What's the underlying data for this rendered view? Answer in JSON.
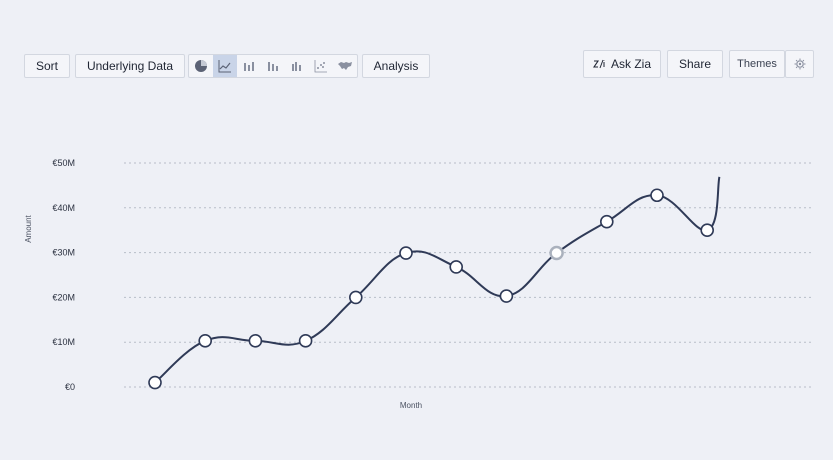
{
  "toolbar": {
    "sort_label": "Sort",
    "underlying_label": "Underlying Data",
    "analysis_label": "Analysis",
    "chart_types": [
      {
        "icon": "pie-chart-icon",
        "active": false
      },
      {
        "icon": "line-chart-icon",
        "active": true
      },
      {
        "icon": "bar-chart-icon",
        "active": false
      },
      {
        "icon": "stacked-bar-chart-icon",
        "active": false
      },
      {
        "icon": "grouped-bar-chart-icon",
        "active": false
      },
      {
        "icon": "scatter-chart-icon",
        "active": false
      },
      {
        "icon": "map-chart-icon",
        "active": false
      }
    ]
  },
  "right_tools": {
    "ask_zia_label": "Ask Zia",
    "ask_zia_icon": "zia-icon",
    "share_label": "Share",
    "themes_label": "Themes",
    "settings_icon": "gear-icon"
  },
  "colors": {
    "line": "#2f3a57",
    "marker_fill": "#ffffff",
    "highlight_marker": "#aab1bd",
    "grid": "#b8bdc8",
    "background": "#eef0f6"
  },
  "chart_data": {
    "type": "line",
    "title": "",
    "xlabel": "Month",
    "ylabel": "Amount",
    "ylim": [
      0,
      50
    ],
    "yticks": [
      0,
      10,
      20,
      30,
      40,
      50
    ],
    "ytick_labels": [
      "€0",
      "€10M",
      "€20M",
      "€30M",
      "€40M",
      "€50M"
    ],
    "grid": true,
    "smooth": true,
    "series": [
      {
        "values": [
          1,
          10.3,
          10.3,
          10.3,
          20,
          29.9,
          26.8,
          20.3,
          29.9,
          36.9,
          42.8,
          35
        ],
        "highlight_index": 8
      }
    ],
    "tail_value": 46.9
  }
}
